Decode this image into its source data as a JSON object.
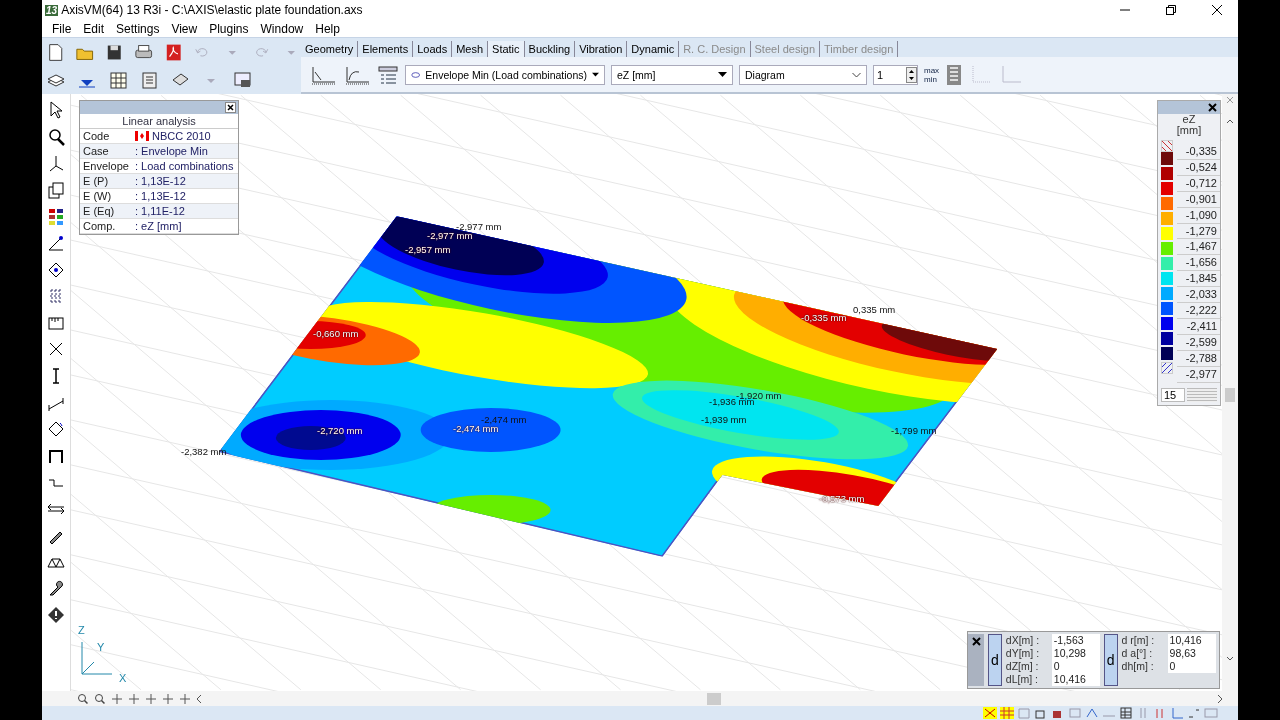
{
  "window": {
    "title": "AxisVM(64) 13 R3i - C:\\AXIS\\elastic plate foundation.axs",
    "app_badge": "13"
  },
  "menu": [
    "File",
    "Edit",
    "Settings",
    "View",
    "Plugins",
    "Window",
    "Help"
  ],
  "tabs": [
    {
      "label": "Geometry",
      "selected": false,
      "disabled": false
    },
    {
      "label": "Elements",
      "selected": false,
      "disabled": false
    },
    {
      "label": "Loads",
      "selected": false,
      "disabled": false
    },
    {
      "label": "Mesh",
      "selected": false,
      "disabled": false
    },
    {
      "label": "Static",
      "selected": true,
      "disabled": false
    },
    {
      "label": "Buckling",
      "selected": false,
      "disabled": false
    },
    {
      "label": "Vibration",
      "selected": false,
      "disabled": false
    },
    {
      "label": "Dynamic",
      "selected": false,
      "disabled": false
    },
    {
      "label": "R. C. Design",
      "selected": false,
      "disabled": true
    },
    {
      "label": "Steel design",
      "selected": false,
      "disabled": true
    },
    {
      "label": "Timber design",
      "selected": false,
      "disabled": true
    }
  ],
  "result_toolbar": {
    "load_case": "Envelope Min (Load combinations)",
    "component": "eZ [mm]",
    "display": "Diagram",
    "index": "1",
    "max_label": "max",
    "min_label": "min"
  },
  "info_panel": {
    "title": "Linear analysis",
    "rows": [
      {
        "label": "Code",
        "value": "NBCC 2010",
        "kind": "flag"
      },
      {
        "label": "Case",
        "value": ": Envelope Min",
        "kind": "text"
      },
      {
        "label": "Envelope",
        "value": ": Load combinations",
        "kind": "text"
      },
      {
        "label": "E (P)",
        "value": ": 1,13E-12",
        "kind": "text"
      },
      {
        "label": "E (W)",
        "value": ": 1,13E-12",
        "kind": "text"
      },
      {
        "label": "E (Eq)",
        "value": ": 1,11E-12",
        "kind": "text"
      },
      {
        "label": "Comp.",
        "value": ": eZ [mm]",
        "kind": "text"
      }
    ]
  },
  "legend": {
    "title": "eZ",
    "unit": "[mm]",
    "values": [
      "-0,335",
      "-0,524",
      "-0,712",
      "-0,901",
      "-1,090",
      "-1,279",
      "-1,467",
      "-1,656",
      "-1,845",
      "-2,033",
      "-2,222",
      "-2,411",
      "-2,599",
      "-2,788",
      "-2,977"
    ],
    "bands": [
      {
        "color": "#6e0a0a"
      },
      {
        "color": "#b00000"
      },
      {
        "color": "#e30000"
      },
      {
        "color": "#ff6a00"
      },
      {
        "color": "#ffae00"
      },
      {
        "color": "#ffff00"
      },
      {
        "color": "#66ee00"
      },
      {
        "color": "#33eeaa"
      },
      {
        "color": "#00e5f0"
      },
      {
        "color": "#00aaff"
      },
      {
        "color": "#0055ff"
      },
      {
        "color": "#0000ee"
      },
      {
        "color": "#0000a0"
      },
      {
        "color": "#000055"
      }
    ],
    "count": "15"
  },
  "plot_labels": [
    {
      "text": "-2,977 mm",
      "kind": "dark"
    },
    {
      "text": "-2,977 mm",
      "kind": "light"
    },
    {
      "text": "-2,957 mm",
      "kind": "light"
    },
    {
      "text": "0,335 mm",
      "kind": "dark"
    },
    {
      "text": "-0,335 mm",
      "kind": "light"
    },
    {
      "text": "-0,660 mm",
      "kind": "light"
    },
    {
      "text": "-2,720 mm",
      "kind": "light"
    },
    {
      "text": "-2,474 mm",
      "kind": "dark"
    },
    {
      "text": "-2,474 mm",
      "kind": "light"
    },
    {
      "text": "-1,920 mm",
      "kind": "dark"
    },
    {
      "text": "-1,936 mm",
      "kind": "dark"
    },
    {
      "text": "-1,939 mm",
      "kind": "dark"
    },
    {
      "text": "-1,799 mm",
      "kind": "dark"
    },
    {
      "text": "-0,573 mm",
      "kind": "light"
    },
    {
      "text": "-2,382 mm",
      "kind": "dark"
    }
  ],
  "axes": {
    "z": "Z",
    "y": "Y",
    "x": "X"
  },
  "coord_panels": [
    {
      "badge": "d",
      "rows": [
        {
          "label": "dX[m] :",
          "value": "-1,563"
        },
        {
          "label": "dY[m] :",
          "value": "10,298"
        },
        {
          "label": "dZ[m] :",
          "value": "0"
        },
        {
          "label": "dL[m] :",
          "value": "10,416"
        }
      ]
    },
    {
      "badge": "d",
      "rows": [
        {
          "label": "d r[m] :",
          "value": "10,416"
        },
        {
          "label": "d a[°] :",
          "value": "98,63"
        },
        {
          "label": "dh[m] :",
          "value": "0"
        }
      ]
    }
  ]
}
